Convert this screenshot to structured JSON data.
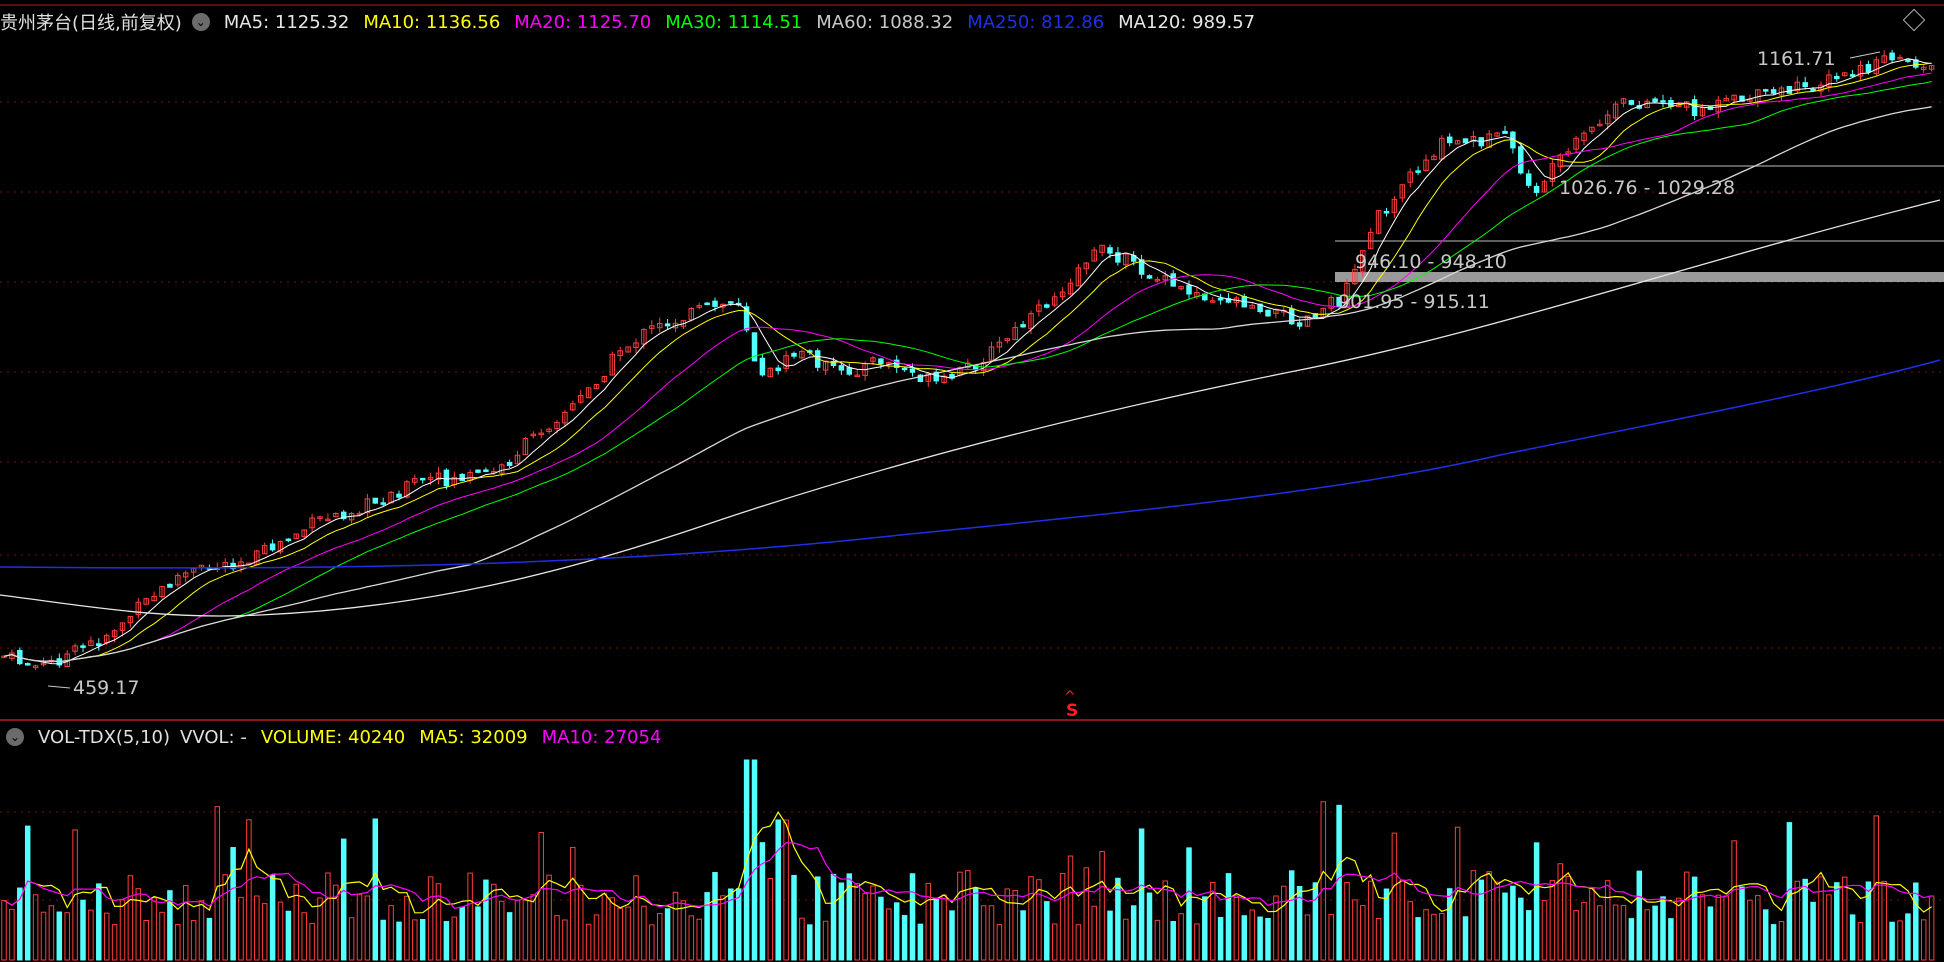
{
  "legend": {
    "stock_title": "贵州茅台(日线,前复权)",
    "items": [
      {
        "text": "MA5: 1125.32",
        "color": "#e6e6e6"
      },
      {
        "text": "MA10: 1136.56",
        "color": "#ffff00"
      },
      {
        "text": "MA20: 1125.70",
        "color": "#ff00ff"
      },
      {
        "text": "MA30: 1114.51",
        "color": "#00ff00"
      },
      {
        "text": "MA60: 1088.32",
        "color": "#c8c8c8"
      },
      {
        "text": "MA250: 812.86",
        "color": "#1f2fe6"
      },
      {
        "text": "MA120: 989.57",
        "color": "#e6e6e6"
      }
    ]
  },
  "vol_legend": {
    "name": "VOL-TDX(5,10)",
    "vvol": "VVOL: -",
    "items": [
      {
        "text": "VOLUME: 40240",
        "color": "#ffff00"
      },
      {
        "text": "MA5: 32009",
        "color": "#ffff00"
      },
      {
        "text": "MA10: 27054",
        "color": "#ff00ff"
      }
    ]
  },
  "annotations": {
    "high": "1161.71",
    "low": "459.17",
    "zone1": "1026.76 - 1029.28",
    "zone2": "946.10 - 948.10",
    "zone3": "901.95 - 915.11",
    "signal": "S"
  },
  "colors": {
    "up": "#ff3c3c",
    "down": "#54ffff",
    "grid": "#7a1010"
  },
  "chart_data": {
    "type": "candlestick",
    "y_range": [
      440,
      1180
    ],
    "levels": [
      1161.71,
      1027.5,
      947.1,
      908.5,
      459.17
    ]
  }
}
